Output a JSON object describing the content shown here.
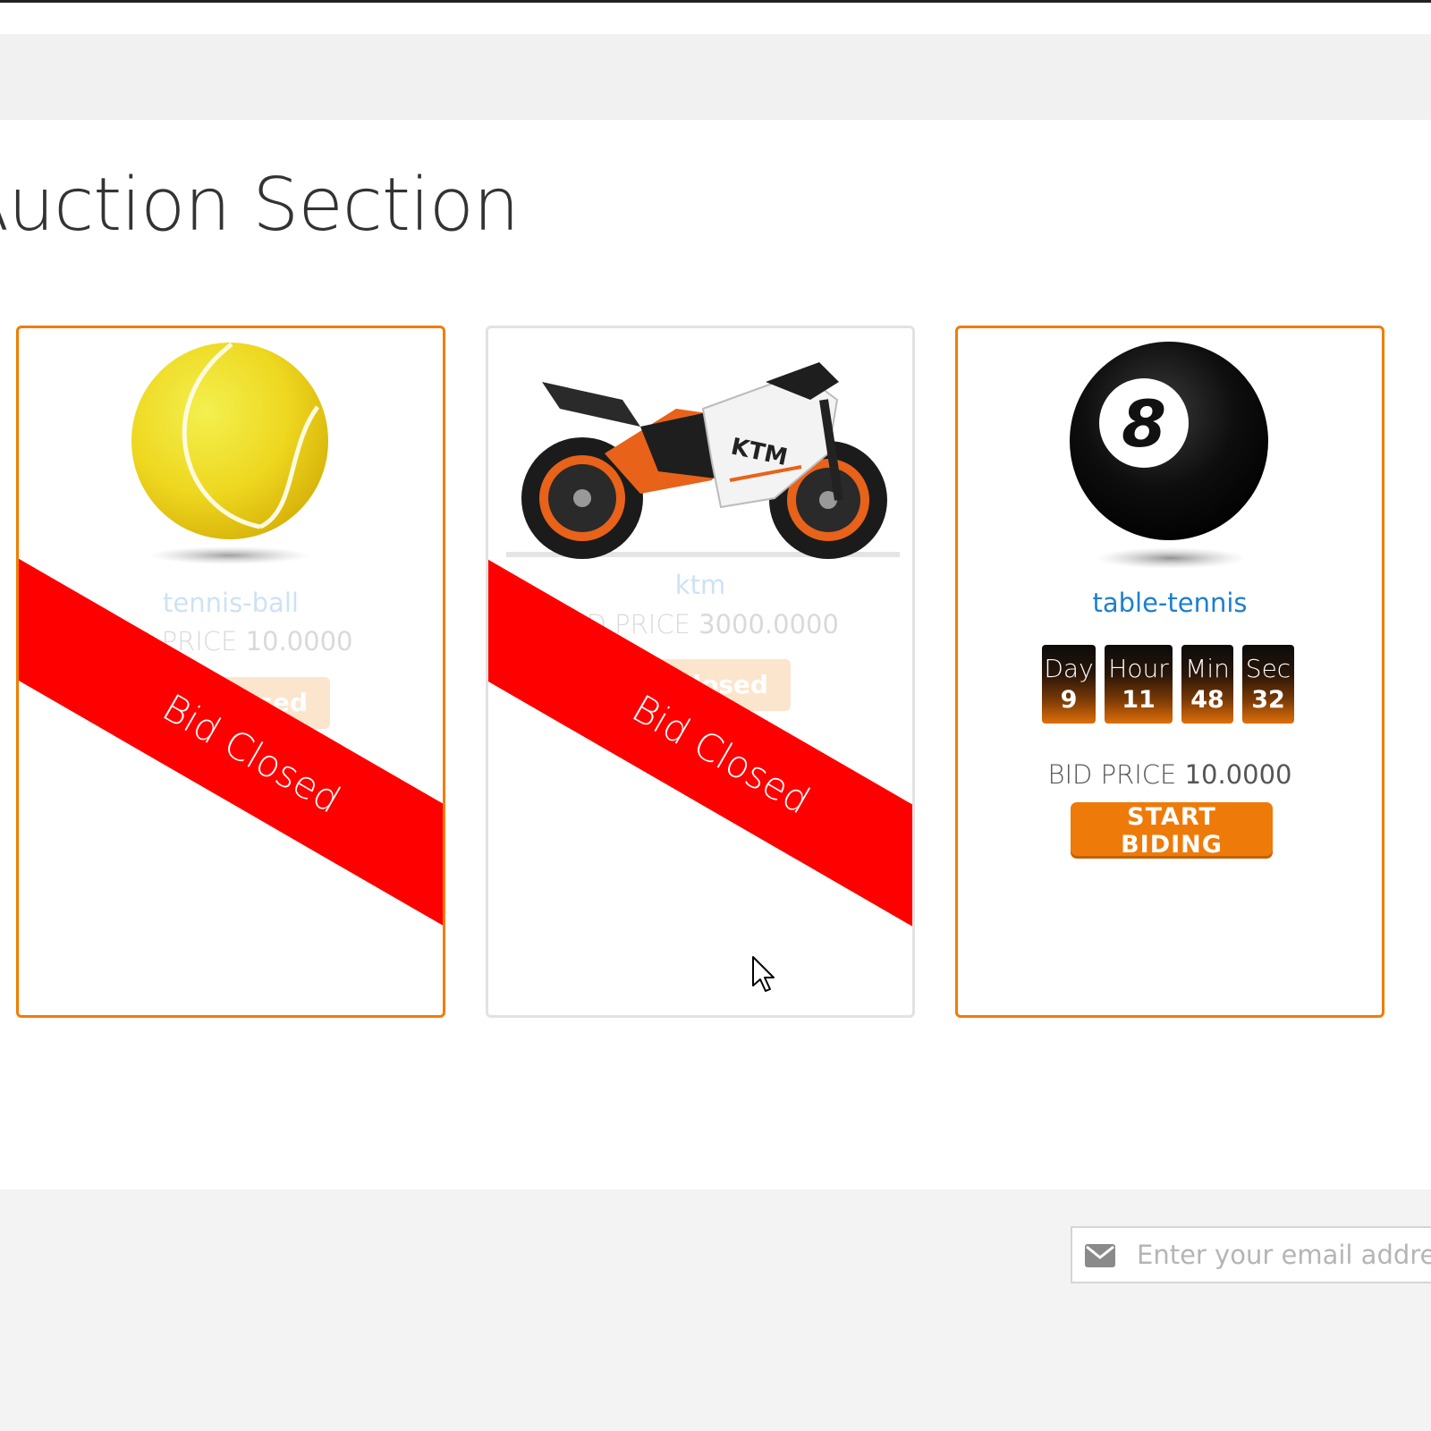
{
  "section": {
    "title": "Auction Section"
  },
  "auctions": [
    {
      "name": "tennis-ball",
      "price_label": "BID PRICE",
      "price_value": "10.0000",
      "button_label": "Bid Closed",
      "ribbon": "Bid Closed",
      "status": "closed"
    },
    {
      "name": "ktm",
      "price_label": "BID PRICE",
      "price_value": "3000.0000",
      "button_label": "Bid Closed",
      "ribbon": "Bid Closed",
      "status": "closed"
    },
    {
      "name": "table-tennis",
      "price_label": "BID PRICE",
      "price_value": "10.0000",
      "button_label": "START BIDING",
      "status": "open",
      "countdown": [
        {
          "label": "Day",
          "value": "9"
        },
        {
          "label": "Hour",
          "value": "11"
        },
        {
          "label": "Min",
          "value": "48"
        },
        {
          "label": "Sec",
          "value": "32"
        }
      ]
    }
  ],
  "footer": {
    "email_placeholder": "Enter your email address",
    "icon": "envelope-icon"
  },
  "colors": {
    "accent": "#f07d00",
    "ribbon": "#ff0000",
    "link": "#1c7fcf"
  }
}
